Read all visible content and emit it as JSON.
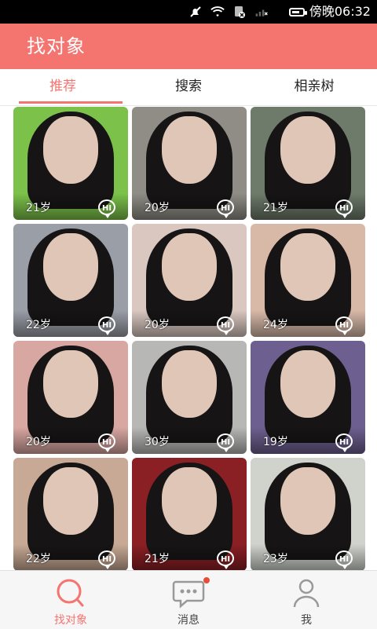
{
  "status": {
    "time": "傍晚06:32"
  },
  "header": {
    "title": "找对象"
  },
  "tabs": [
    {
      "label": "推荐",
      "active": true
    },
    {
      "label": "搜索",
      "active": false
    },
    {
      "label": "相亲树",
      "active": false
    }
  ],
  "profiles": [
    {
      "age": "21岁",
      "bg": "#7cc24a"
    },
    {
      "age": "20岁",
      "bg": "#8f8d85"
    },
    {
      "age": "21岁",
      "bg": "#6e7a6a"
    },
    {
      "age": "22岁",
      "bg": "#9a9ea7"
    },
    {
      "age": "20岁",
      "bg": "#d9c7c0"
    },
    {
      "age": "24岁",
      "bg": "#d8b9a8"
    },
    {
      "age": "20岁",
      "bg": "#d9a7a2"
    },
    {
      "age": "30岁",
      "bg": "#b7b8b6"
    },
    {
      "age": "19岁",
      "bg": "#6d5f8f"
    },
    {
      "age": "22岁",
      "bg": "#c8a995"
    },
    {
      "age": "21岁",
      "bg": "#8a1f24"
    },
    {
      "age": "23岁",
      "bg": "#cfd3cc"
    }
  ],
  "hi_label": "HI",
  "bottom_nav": [
    {
      "label": "找对象",
      "active": true
    },
    {
      "label": "消息",
      "active": false,
      "badge": true
    },
    {
      "label": "我",
      "active": false
    }
  ],
  "colors": {
    "accent": "#f47470"
  }
}
